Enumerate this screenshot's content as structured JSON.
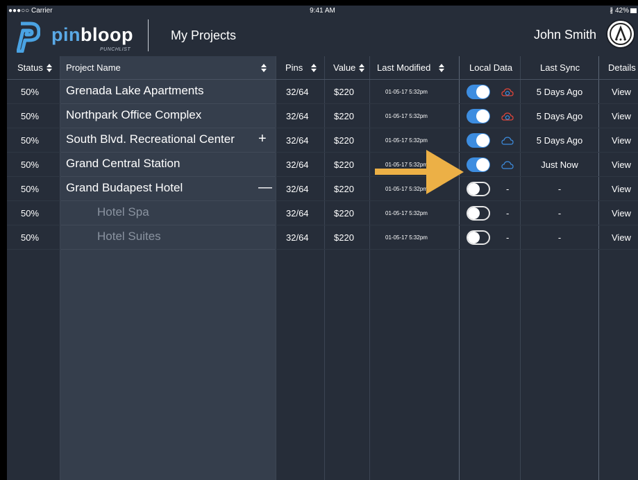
{
  "status_bar": {
    "carrier": "●●●○○ Carrier",
    "time": "9:41 AM",
    "battery": "∦ 42%"
  },
  "header": {
    "logo_main": "pinbloop",
    "logo_pin": "pin",
    "logo_rest": "bloop",
    "logo_sub": "PUNCHLIST",
    "title": "My Projects",
    "user": "John Smith"
  },
  "columns": {
    "status": "Status",
    "name": "Project Name",
    "pins": "Pins",
    "value": "Value",
    "modified": "Last Modified",
    "local": "Local Data",
    "sync": "Last Sync",
    "details": "Details"
  },
  "rows": [
    {
      "status": "50%",
      "name": "Grenada Lake Apartments",
      "pins": "32/64",
      "value": "$220",
      "modified": "01-05-17  5:32pm",
      "local_on": true,
      "cloud": "sync",
      "sync": "5 Days Ago",
      "details": "View",
      "expand": "",
      "child": false
    },
    {
      "status": "50%",
      "name": "Northpark Office Complex",
      "pins": "32/64",
      "value": "$220",
      "modified": "01-05-17  5:32pm",
      "local_on": true,
      "cloud": "sync",
      "sync": "5 Days Ago",
      "details": "View",
      "expand": "",
      "child": false
    },
    {
      "status": "50%",
      "name": "South Blvd. Recreational Center",
      "pins": "32/64",
      "value": "$220",
      "modified": "01-05-17  5:32pm",
      "local_on": true,
      "cloud": "plain",
      "sync": "5 Days Ago",
      "details": "View",
      "expand": "+",
      "child": false
    },
    {
      "status": "50%",
      "name": "Grand Central Station",
      "pins": "32/64",
      "value": "$220",
      "modified": "01-05-17  5:32pm",
      "local_on": true,
      "cloud": "plain",
      "sync": "Just Now",
      "details": "View",
      "expand": "",
      "child": false
    },
    {
      "status": "50%",
      "name": "Grand Budapest Hotel",
      "pins": "32/64",
      "value": "$220",
      "modified": "01-05-17  5:32pm",
      "local_on": false,
      "cloud": "none",
      "sync": "-",
      "details": "View",
      "expand": "—",
      "child": false
    },
    {
      "status": "50%",
      "name": "Hotel Spa",
      "pins": "32/64",
      "value": "$220",
      "modified": "01-05-17  5:32pm",
      "local_on": false,
      "cloud": "none",
      "sync": "-",
      "details": "View",
      "expand": "",
      "child": true
    },
    {
      "status": "50%",
      "name": "Hotel Suites",
      "pins": "32/64",
      "value": "$220",
      "modified": "01-05-17  5:32pm",
      "local_on": false,
      "cloud": "none",
      "sync": "-",
      "details": "View",
      "expand": "",
      "child": true
    }
  ],
  "dash": "-",
  "icons": {
    "cloud_sync": "cloud-sync-icon",
    "cloud": "cloud-icon",
    "annotation": "arrow-annotation"
  },
  "colors": {
    "background": "#262d39",
    "name_column": "#353e4c",
    "toggle_on": "#3d8de0",
    "accent_logo": "#5aa9e6",
    "cloud_sync": "#e0453a",
    "cloud": "#3d8de0",
    "arrow": "#ecb046"
  }
}
